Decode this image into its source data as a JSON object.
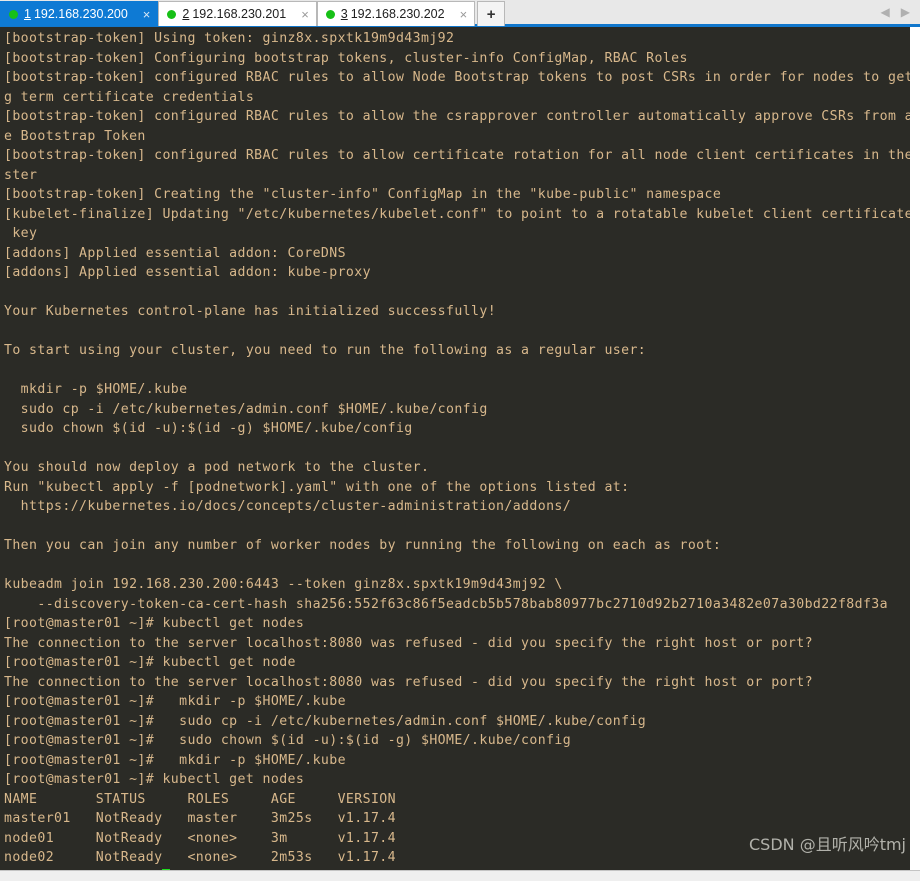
{
  "window": {
    "tabs": [
      {
        "number": "1",
        "host": "192.168.230.200",
        "status_icon": "connected-dot",
        "close_label": "×",
        "active": true
      },
      {
        "number": "2",
        "host": "192.168.230.201",
        "status_icon": "connected-dot",
        "close_label": "×",
        "active": false
      },
      {
        "number": "3",
        "host": "192.168.230.202",
        "status_icon": "connected-dot",
        "close_label": "×",
        "active": false
      }
    ],
    "new_tab_label": "+",
    "nav_prev_label": "◀",
    "nav_next_label": "▶",
    "accent_color": "#0e7ad4",
    "tabbar_background": "#e8e8e8"
  },
  "terminal": {
    "background_color": "#2b2b26",
    "text_color": "#d8b88c",
    "cursor_color": "#1ee01e",
    "prompt": "[root@master01 ~]#",
    "token": "ginz8x.spxtk19m9d43mj92",
    "api_endpoint": "192.168.230.200:6443",
    "ca_cert_hash": "sha256:552f63c86f5eadcb5b578bab80977bc2710d92b2710a3482e07a30bd22f8df3a",
    "lines": [
      "[bootstrap-token] Using token: ginz8x.spxtk19m9d43mj92",
      "[bootstrap-token] Configuring bootstrap tokens, cluster-info ConfigMap, RBAC Roles",
      "[bootstrap-token] configured RBAC rules to allow Node Bootstrap tokens to post CSRs in order for nodes to get lon",
      "g term certificate credentials",
      "[bootstrap-token] configured RBAC rules to allow the csrapprover controller automatically approve CSRs from a Nod",
      "e Bootstrap Token",
      "[bootstrap-token] configured RBAC rules to allow certificate rotation for all node client certificates in the clu",
      "ster",
      "[bootstrap-token] Creating the \"cluster-info\" ConfigMap in the \"kube-public\" namespace",
      "[kubelet-finalize] Updating \"/etc/kubernetes/kubelet.conf\" to point to a rotatable kubelet client certificate and",
      " key",
      "[addons] Applied essential addon: CoreDNS",
      "[addons] Applied essential addon: kube-proxy",
      "",
      "Your Kubernetes control-plane has initialized successfully!",
      "",
      "To start using your cluster, you need to run the following as a regular user:",
      "",
      "  mkdir -p $HOME/.kube",
      "  sudo cp -i /etc/kubernetes/admin.conf $HOME/.kube/config",
      "  sudo chown $(id -u):$(id -g) $HOME/.kube/config",
      "",
      "You should now deploy a pod network to the cluster.",
      "Run \"kubectl apply -f [podnetwork].yaml\" with one of the options listed at:",
      "  https://kubernetes.io/docs/concepts/cluster-administration/addons/",
      "",
      "Then you can join any number of worker nodes by running the following on each as root:",
      "",
      "kubeadm join 192.168.230.200:6443 --token ginz8x.spxtk19m9d43mj92 \\",
      "    --discovery-token-ca-cert-hash sha256:552f63c86f5eadcb5b578bab80977bc2710d92b2710a3482e07a30bd22f8df3a",
      "[root@master01 ~]# kubectl get nodes",
      "The connection to the server localhost:8080 was refused - did you specify the right host or port?",
      "[root@master01 ~]# kubectl get node",
      "The connection to the server localhost:8080 was refused - did you specify the right host or port?",
      "[root@master01 ~]#   mkdir -p $HOME/.kube",
      "[root@master01 ~]#   sudo cp -i /etc/kubernetes/admin.conf $HOME/.kube/config",
      "[root@master01 ~]#   sudo chown $(id -u):$(id -g) $HOME/.kube/config",
      "[root@master01 ~]#   mkdir -p $HOME/.kube",
      "[root@master01 ~]# kubectl get nodes",
      "NAME       STATUS     ROLES     AGE     VERSION",
      "master01   NotReady   master    3m25s   v1.17.4",
      "node01     NotReady   <none>    3m      v1.17.4",
      "node02     NotReady   <none>    2m53s   v1.17.4"
    ],
    "last_prompt": "[root@master01 ~]# ",
    "nodes_table": {
      "columns": [
        "NAME",
        "STATUS",
        "ROLES",
        "AGE",
        "VERSION"
      ],
      "rows": [
        [
          "master01",
          "NotReady",
          "master",
          "3m25s",
          "v1.17.4"
        ],
        [
          "node01",
          "NotReady",
          "<none>",
          "3m",
          "v1.17.4"
        ],
        [
          "node02",
          "NotReady",
          "<none>",
          "2m53s",
          "v1.17.4"
        ]
      ]
    }
  },
  "watermark": "CSDN @且听风吟tmj"
}
